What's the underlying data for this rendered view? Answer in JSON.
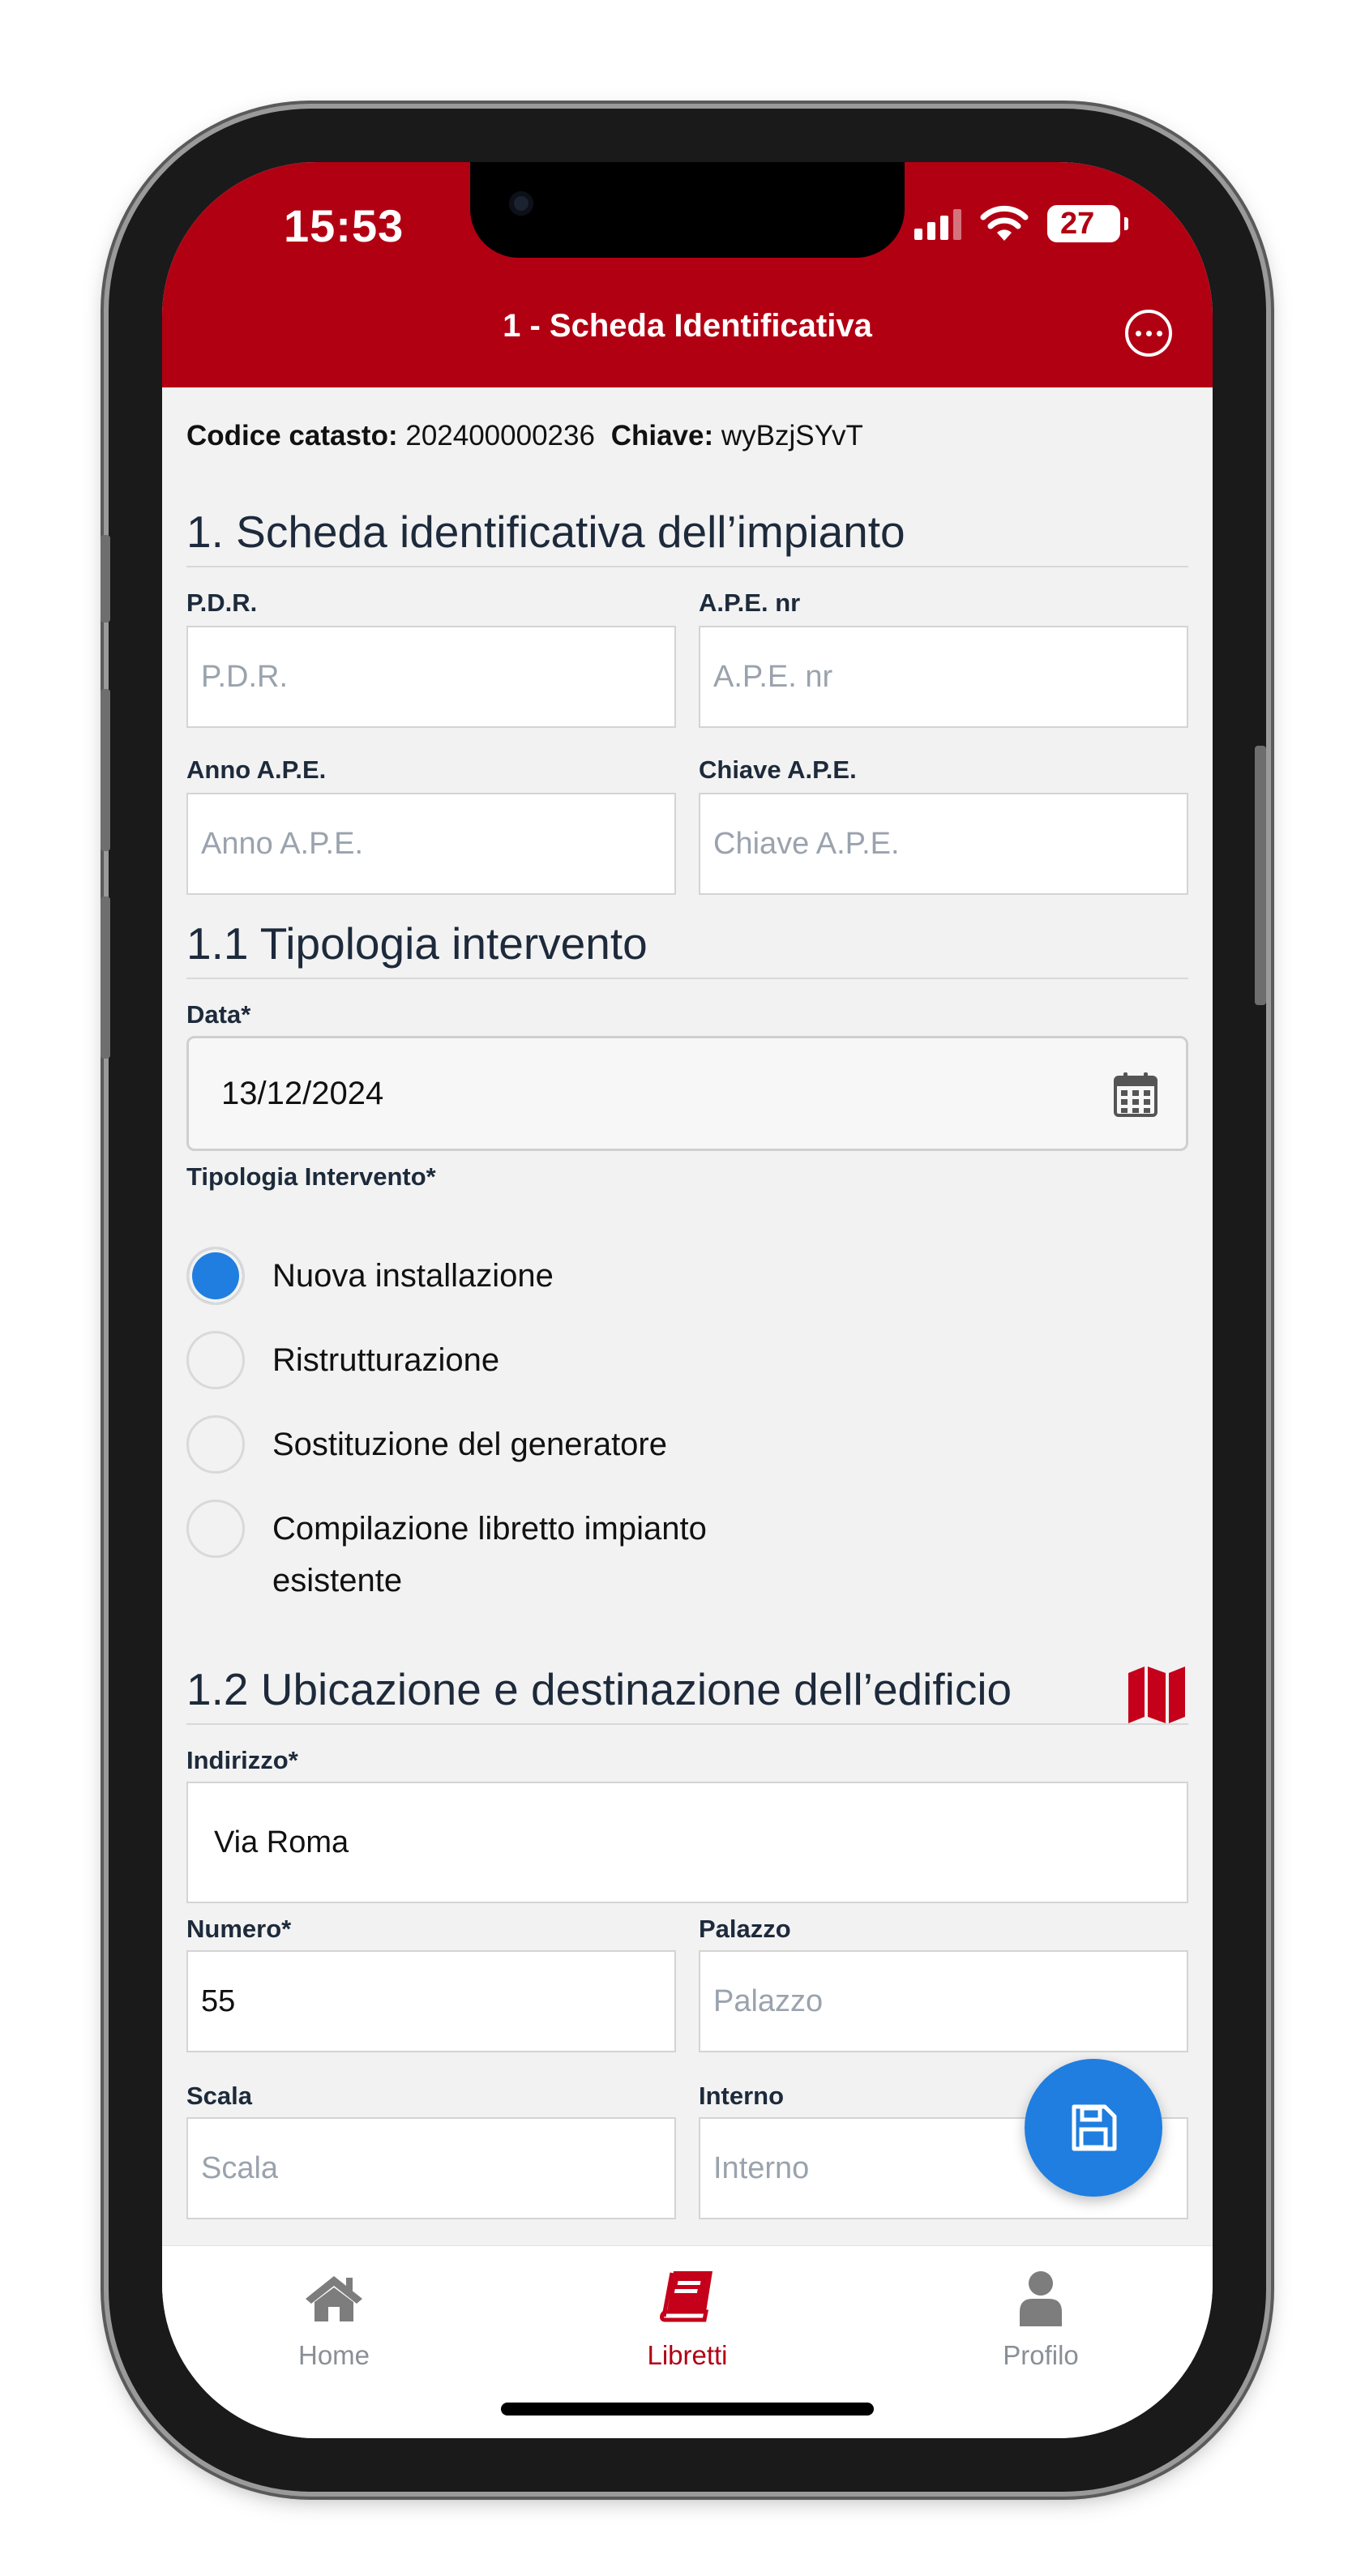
{
  "status_bar": {
    "time": "15:53",
    "battery": "27"
  },
  "header": {
    "title": "1 - Scheda Identificativa"
  },
  "codice": {
    "catasto_label": "Codice catasto:",
    "catasto_value": "202400000236",
    "chiave_label": "Chiave:",
    "chiave_value": "wyBzjSYvT"
  },
  "section1": {
    "title": "1. Scheda identificativa dell’impianto",
    "pdr": {
      "label": "P.D.R.",
      "placeholder": "P.D.R."
    },
    "ape_nr": {
      "label": "A.P.E. nr",
      "placeholder": "A.P.E. nr"
    },
    "anno_ape": {
      "label": "Anno A.P.E.",
      "placeholder": "Anno A.P.E."
    },
    "chiave_ape": {
      "label": "Chiave A.P.E.",
      "placeholder": "Chiave A.P.E."
    }
  },
  "section11": {
    "title": "1.1 Tipologia intervento",
    "data_label": "Data*",
    "data_value": "13/12/2024",
    "tipologia_label": "Tipologia Intervento*",
    "options": [
      {
        "label": "Nuova installazione",
        "selected": true
      },
      {
        "label": "Ristrutturazione",
        "selected": false
      },
      {
        "label": "Sostituzione del generatore",
        "selected": false
      },
      {
        "label": "Compilazione libretto impianto esistente",
        "selected": false
      }
    ]
  },
  "section12": {
    "title": "1.2 Ubicazione e destinazione dell’edificio",
    "indirizzo": {
      "label": "Indirizzo*",
      "value": "Via Roma"
    },
    "numero": {
      "label": "Numero*",
      "value": "55"
    },
    "palazzo": {
      "label": "Palazzo",
      "placeholder": "Palazzo"
    },
    "scala": {
      "label": "Scala",
      "placeholder": "Scala"
    },
    "interno": {
      "label": "Interno",
      "placeholder": "Interno"
    }
  },
  "tabs": [
    {
      "label": "Home",
      "icon": "home-icon"
    },
    {
      "label": "Libretti",
      "icon": "book-icon",
      "active": true
    },
    {
      "label": "Profilo",
      "icon": "user-icon"
    }
  ],
  "colors": {
    "brand": "#b20013",
    "accent": "#1f7ee0",
    "background": "#f2f2f2"
  }
}
